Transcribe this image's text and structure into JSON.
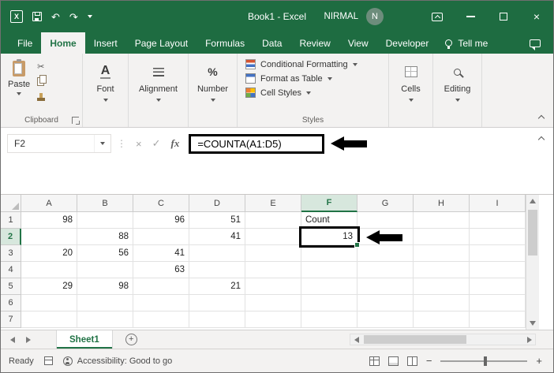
{
  "colors": {
    "titlebar_green": "#1e6c41",
    "accent_green": "#217346",
    "ribbon_bg": "#f3f2f1"
  },
  "titlebar": {
    "title": "Book1 - Excel",
    "user_name": "NIRMAL",
    "avatar_initial": "N"
  },
  "icons": {
    "excel_logo": "X",
    "undo": "↶",
    "redo": "↷",
    "close": "×",
    "cancel": "×",
    "enter": "✓",
    "fx": "fx",
    "cut": "✂",
    "name_box_dots": "⋮",
    "plus": "+",
    "zoom_out": "−",
    "zoom_in": "+"
  },
  "ribbon_tabs": [
    "File",
    "Home",
    "Insert",
    "Page Layout",
    "Formulas",
    "Data",
    "Review",
    "View",
    "Developer"
  ],
  "active_tab": "Home",
  "tell_me_label": "Tell me",
  "ribbon": {
    "paste_label": "Paste",
    "clipboard_label": "Clipboard",
    "font_label": "Font",
    "font_icon_letter": "A",
    "alignment_label": "Alignment",
    "number_label": "Number",
    "number_icon": "%",
    "styles_items": [
      "Conditional Formatting",
      "Format as Table",
      "Cell Styles"
    ],
    "styles_label": "Styles",
    "cells_label": "Cells",
    "editing_label": "Editing"
  },
  "formula_bar": {
    "name_box": "F2",
    "formula": "=COUNTA(A1:D5)"
  },
  "grid": {
    "columns": [
      "A",
      "B",
      "C",
      "D",
      "E",
      "F",
      "G",
      "H",
      "I"
    ],
    "rows": [
      1,
      2,
      3,
      4,
      5,
      6,
      7
    ],
    "selected_cell": "F2",
    "selected_column": "F",
    "selected_row": 2,
    "cells": [
      {
        "ref": "A1",
        "value": "98",
        "align": "right"
      },
      {
        "ref": "C1",
        "value": "96",
        "align": "right"
      },
      {
        "ref": "D1",
        "value": "51",
        "align": "right"
      },
      {
        "ref": "F1",
        "value": "Count",
        "align": "left"
      },
      {
        "ref": "B2",
        "value": "88",
        "align": "right"
      },
      {
        "ref": "D2",
        "value": "41",
        "align": "right"
      },
      {
        "ref": "F2",
        "value": "13",
        "align": "right"
      },
      {
        "ref": "A3",
        "value": "20",
        "align": "right"
      },
      {
        "ref": "B3",
        "value": "56",
        "align": "right"
      },
      {
        "ref": "C3",
        "value": "41",
        "align": "right"
      },
      {
        "ref": "C4",
        "value": "63",
        "align": "right"
      },
      {
        "ref": "A5",
        "value": "29",
        "align": "right"
      },
      {
        "ref": "B5",
        "value": "98",
        "align": "right"
      },
      {
        "ref": "D5",
        "value": "21",
        "align": "right"
      }
    ]
  },
  "sheet_tabs": {
    "active_tab": "Sheet1"
  },
  "status_bar": {
    "mode": "Ready",
    "accessibility": "Accessibility: Good to go"
  }
}
